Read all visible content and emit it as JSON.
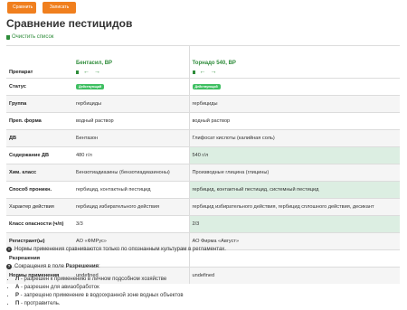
{
  "header": {
    "buttons": [
      "Сравнить",
      "Записать"
    ],
    "title": "Сравнение пестицидов",
    "clear_link": "Очистить список"
  },
  "products": [
    {
      "name": "Бентасил, ВР"
    },
    {
      "name": "Торнадо 540, ВР"
    }
  ],
  "table": {
    "header_label": "Препарат",
    "rows": [
      {
        "label": "Статус",
        "bold": true,
        "zebra": false,
        "diff": false,
        "badge": true,
        "values": [
          "Действующий",
          "Действующий"
        ]
      },
      {
        "label": "Группа",
        "bold": true,
        "zebra": true,
        "diff": false,
        "values": [
          "гербициды",
          "гербициды"
        ]
      },
      {
        "label": "Преп. форма",
        "bold": true,
        "zebra": false,
        "diff": false,
        "values": [
          "водный раствор",
          "водный раствор"
        ]
      },
      {
        "label": "ДВ",
        "bold": true,
        "zebra": true,
        "diff": true,
        "values": [
          "Бентазон",
          "Глифосат кислоты (калийная соль)"
        ]
      },
      {
        "label": "Содержание ДВ",
        "bold": true,
        "zebra": false,
        "diff": true,
        "values": [
          "480 г/л",
          "540 г/л"
        ]
      },
      {
        "label": "Хим. класс",
        "bold": true,
        "zebra": true,
        "diff": true,
        "values": [
          "Бензотиадиазины (бензотиадиазиноны)",
          "Производные глицина (глицины)"
        ]
      },
      {
        "label": "Способ проникн.",
        "bold": true,
        "zebra": false,
        "diff": true,
        "values": [
          "гербицид, контактный пестицид",
          "гербицид, контактный пестицид, системный пестицид"
        ]
      },
      {
        "label": "Характер действия",
        "bold": false,
        "zebra": true,
        "diff": true,
        "values": [
          "гербицид избирательного действия",
          "гербицид избирательного действия, гербицид сплошного действия, десикант"
        ]
      },
      {
        "label": "Класс опасности (ч/п)",
        "bold": true,
        "zebra": false,
        "diff": true,
        "values": [
          "3/3",
          "2/3"
        ]
      },
      {
        "label": "Регистрант(ы)",
        "bold": true,
        "zebra": true,
        "diff": false,
        "values": [
          "АО «ФМРус»",
          "АО Фирма «Август»"
        ]
      },
      {
        "label": "Разрешения",
        "bold": true,
        "zebra": false,
        "diff": false,
        "values": [
          "",
          ""
        ]
      },
      {
        "label": "Нормы применения",
        "bold": true,
        "zebra": true,
        "diff": false,
        "values": [
          "undefined",
          "undefined"
        ]
      }
    ]
  },
  "notes": {
    "note1": "Нормы применения сравниваются только по опознанным культурам в регламентах.",
    "note2_prefix": "Сокращения в поле ",
    "note2_field": "Разрешения",
    "note2_suffix": ":",
    "legend": [
      {
        "key": "Л",
        "text": " - разрешен к применению в личном подсобном хозяйстве"
      },
      {
        "key": "А",
        "text": " - разрешен для авиаобработок"
      },
      {
        "key": "Р",
        "text": " - запрещено применение в водоохранной зоне водных объектов"
      },
      {
        "key": "П",
        "text": " - протравитель."
      }
    ]
  },
  "colors": {
    "accent_orange": "#f07f1e",
    "accent_green": "#2e8c3a",
    "badge_green": "#3fbf62",
    "diff_bg": "#dceee2"
  }
}
